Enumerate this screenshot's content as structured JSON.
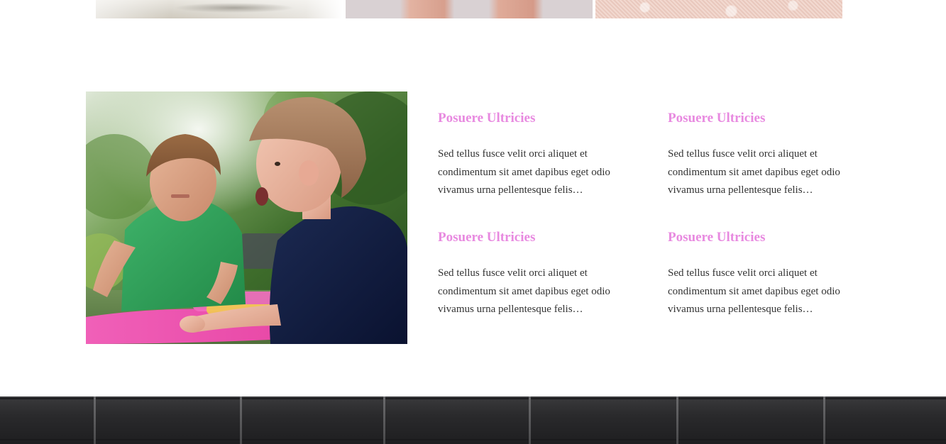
{
  "gallery": {
    "tiles": [
      {
        "name": "gallery-photo-1"
      },
      {
        "name": "gallery-photo-2"
      },
      {
        "name": "gallery-photo-3"
      }
    ]
  },
  "feature_photo": {
    "subject": "two boys playing outdoors"
  },
  "features": [
    {
      "title": "Posuere Ultricies",
      "text": "Sed tellus fusce velit orci aliquet et condimentum sit amet dapibus eget odio vivamus urna pellentesque felis…"
    },
    {
      "title": "Posuere Ultricies",
      "text": "Sed tellus fusce velit orci aliquet et condimentum sit amet dapibus eget odio vivamus urna pellentesque felis…"
    },
    {
      "title": "Posuere Ultricies",
      "text": "Sed tellus fusce velit orci aliquet et condimentum sit amet dapibus eget odio vivamus urna pellentesque felis…"
    },
    {
      "title": "Posuere Ultricies",
      "text": "Sed tellus fusce velit orci aliquet et condimentum sit amet dapibus eget odio vivamus urna pellentesque felis…"
    }
  ],
  "colors": {
    "accent": "#e88ae0",
    "body_text": "#333333",
    "footer_bg": "#2a2a2c"
  }
}
